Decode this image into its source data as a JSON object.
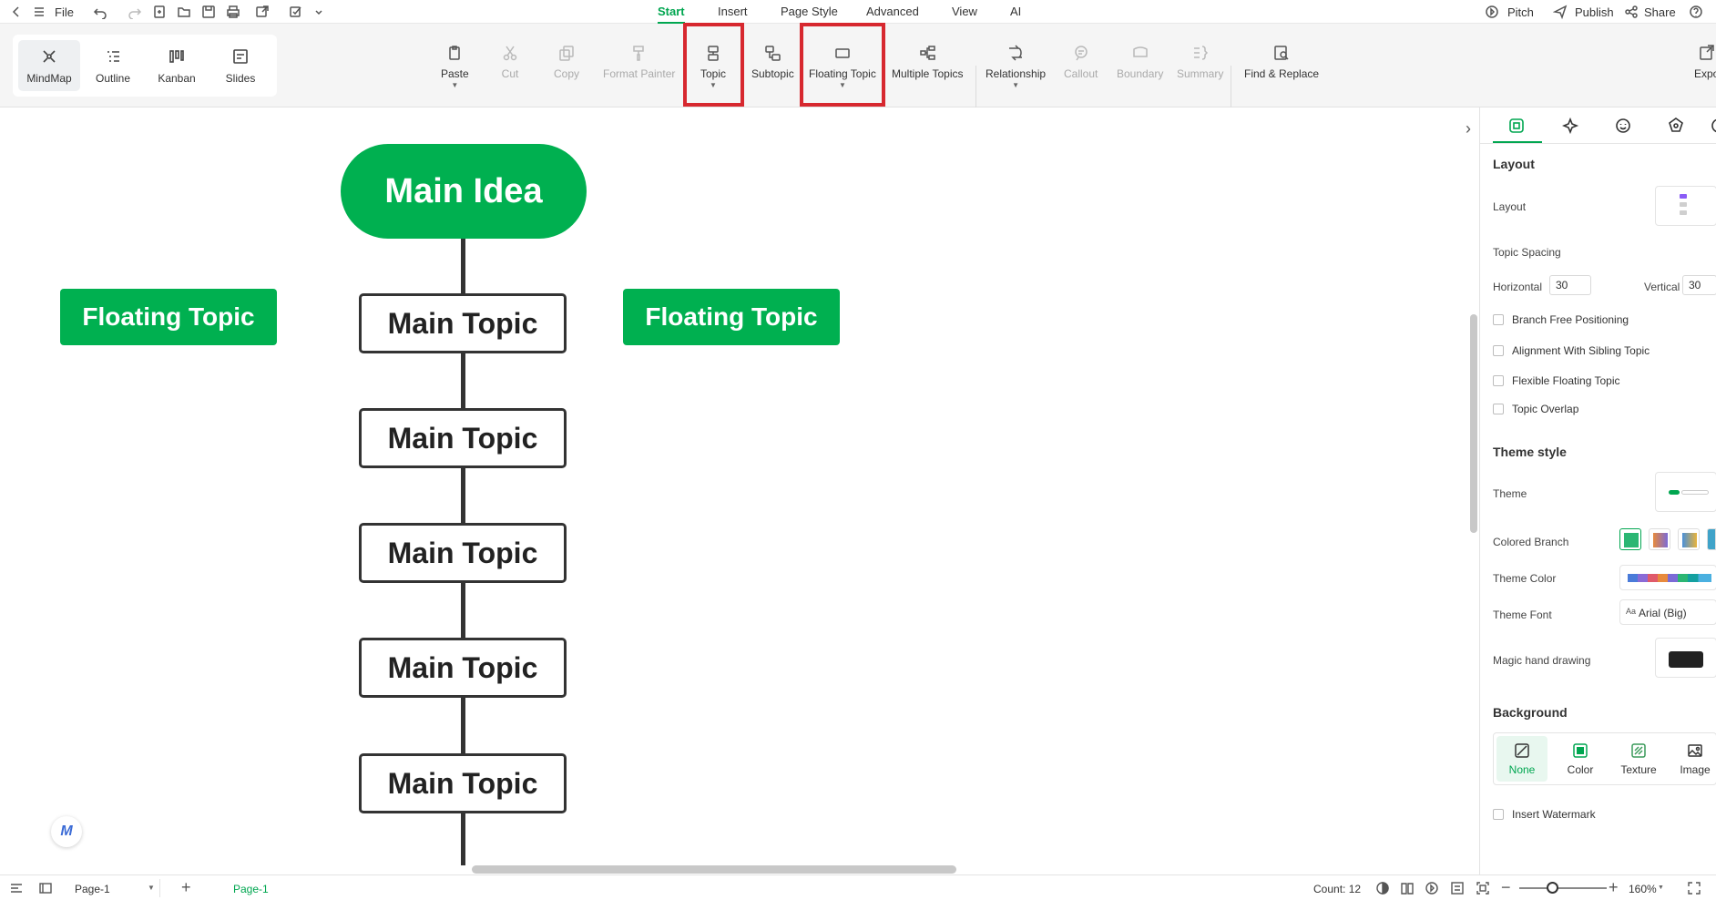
{
  "menubar": {
    "file_label": "File",
    "tabs": [
      "Start",
      "Insert",
      "Page Style",
      "Advanced",
      "View",
      "AI"
    ],
    "active_tab": "Start",
    "pitch_label": "Pitch",
    "publish_label": "Publish",
    "share_label": "Share"
  },
  "views": [
    {
      "label": "MindMap",
      "icon": "mindmap-icon",
      "active": true
    },
    {
      "label": "Outline",
      "icon": "outline-icon",
      "active": false
    },
    {
      "label": "Kanban",
      "icon": "kanban-icon",
      "active": false
    },
    {
      "label": "Slides",
      "icon": "slides-icon",
      "active": false
    }
  ],
  "toolbar": {
    "paste": "Paste",
    "cut": "Cut",
    "copy": "Copy",
    "format_painter": "Format Painter",
    "topic": "Topic",
    "subtopic": "Subtopic",
    "floating_topic": "Floating Topic",
    "multiple_topics": "Multiple Topics",
    "relationship": "Relationship",
    "callout": "Callout",
    "boundary": "Boundary",
    "summary": "Summary",
    "find_replace": "Find & Replace",
    "export": "Expo"
  },
  "canvas": {
    "main_idea": "Main Idea",
    "main_topics": [
      "Main Topic",
      "Main Topic",
      "Main Topic",
      "Main Topic",
      "Main Topic"
    ],
    "floating_left": "Floating Topic",
    "floating_right": "Floating Topic"
  },
  "panel": {
    "layout_heading": "Layout",
    "layout_label": "Layout",
    "topic_spacing_label": "Topic Spacing",
    "horizontal_label": "Horizontal",
    "horizontal_value": "30",
    "vertical_label": "Vertical",
    "vertical_value": "30",
    "checkboxes": [
      "Branch Free Positioning",
      "Alignment With Sibling Topic",
      "Flexible Floating Topic",
      "Topic Overlap"
    ],
    "theme_style_heading": "Theme style",
    "theme_label": "Theme",
    "colored_branch_label": "Colored Branch",
    "theme_color_label": "Theme Color",
    "theme_font_label": "Theme Font",
    "theme_font_value": "Arial (Big)",
    "magic_hand_label": "Magic hand drawing",
    "background_heading": "Background",
    "bg_options": [
      "None",
      "Color",
      "Texture",
      "Image"
    ],
    "insert_watermark": "Insert Watermark"
  },
  "statusbar": {
    "page_select": "Page-1",
    "page_tab": "Page-1",
    "count": "Count: 12",
    "zoom": "160%"
  },
  "colors": {
    "accent": "#00a650",
    "topic_fill": "#00b050",
    "highlight": "#d7282f"
  }
}
